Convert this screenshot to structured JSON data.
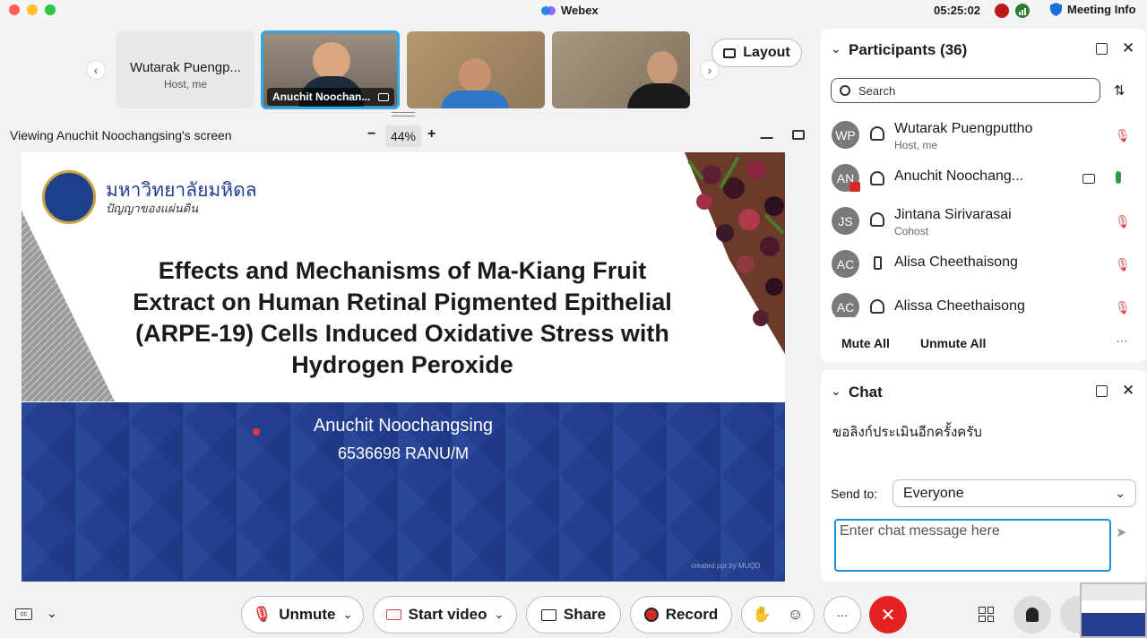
{
  "app": {
    "name": "Webex",
    "clock": "05:25:02",
    "meeting_info": "Meeting Info"
  },
  "tiles": [
    {
      "name": "Wutarak Puengp...",
      "sub": "Host, me"
    },
    {
      "name": "Anuchit Noochan..."
    }
  ],
  "view": {
    "layout_label": "Layout",
    "viewing_text": "Viewing Anuchit Noochangsing's screen",
    "zoom": "44%",
    "zoom_minus": "−",
    "zoom_plus": "+"
  },
  "slide": {
    "university_thai": "มหาวิทยาลัยมหิดล",
    "motto_thai": "ปัญญาของแผ่นดิน",
    "title_lines": [
      "Effects and Mechanisms of Ma-Kiang Fruit",
      "Extract on Human Retinal Pigmented Epithelial",
      "(ARPE-19) Cells Induced Oxidative Stress with",
      "Hydrogen Peroxide"
    ],
    "presenter": "Anuchit Noochangsing",
    "student_id": "6536698 RANU/M",
    "credit": "created ppt by MUQD",
    "colors": {
      "banner": "#243f8f"
    }
  },
  "participants": {
    "title": "Participants (36)",
    "search_placeholder": "Search",
    "list": [
      {
        "initials": "WP",
        "name": "Wutarak Puengputtho",
        "role": "Host, me",
        "device": "headset-icon",
        "mic": "muted"
      },
      {
        "initials": "AN",
        "name": "Anuchit Noochang...",
        "role": "",
        "device": "headset-icon",
        "mic": "active",
        "video": true,
        "sharing": true
      },
      {
        "initials": "JS",
        "name": "Jintana Sirivarasai",
        "role": "Cohost",
        "device": "headset-icon",
        "mic": "muted"
      },
      {
        "initials": "AC",
        "name": "Alisa Cheethaisong",
        "role": "",
        "device": "phone-icon",
        "mic": "muted"
      },
      {
        "initials": "AC",
        "name": "Alissa Cheethaisong",
        "role": "",
        "device": "headset-icon",
        "mic": "muted"
      }
    ],
    "mute_all": "Mute All",
    "unmute_all": "Unmute All",
    "more": "···"
  },
  "chat": {
    "title": "Chat",
    "message": "ขอลิงก์ประเมินอีกครั้งครับ",
    "send_to_label": "Send to:",
    "send_to_value": "Everyone",
    "input_placeholder": "Enter chat message here"
  },
  "controls": {
    "unmute": "Unmute",
    "start_video": "Start video",
    "share": "Share",
    "record": "Record",
    "more": "···"
  },
  "colors": {
    "accent": "#1d8fe1",
    "danger": "#e52222",
    "muted_mic": "#d93d3d",
    "active_mic": "#2a9d4a"
  }
}
